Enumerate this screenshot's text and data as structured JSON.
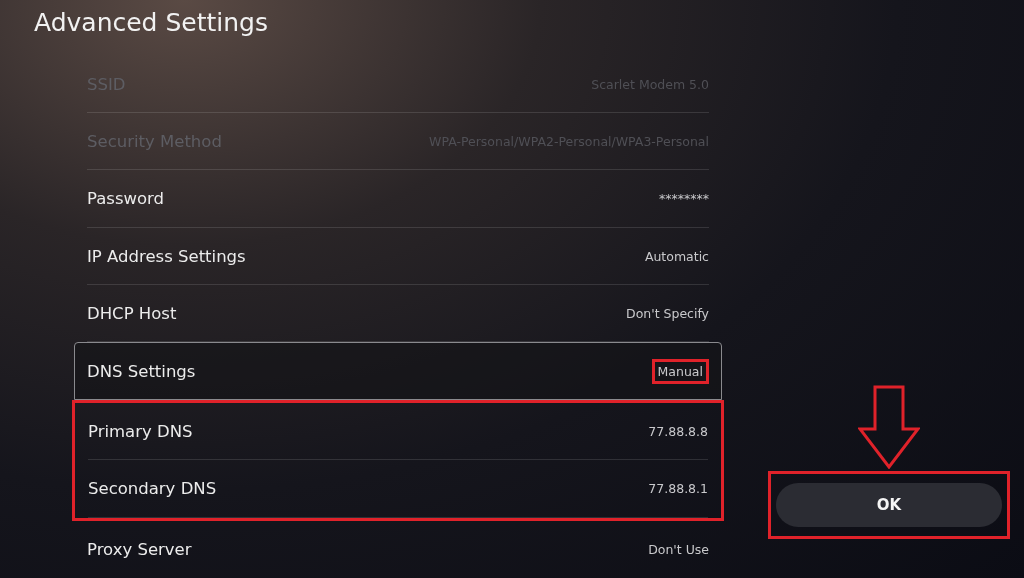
{
  "title": "Advanced Settings",
  "rows": [
    {
      "label": "SSID",
      "value": "Scarlet Modem 5.0",
      "disabled": true,
      "focused": false,
      "value_marked": false,
      "boxed": false
    },
    {
      "label": "Security Method",
      "value": "WPA-Personal/WPA2-Personal/WPA3-Personal",
      "disabled": true,
      "focused": false,
      "value_marked": false,
      "boxed": false
    },
    {
      "label": "Password",
      "value": "********",
      "disabled": false,
      "focused": false,
      "value_marked": false,
      "boxed": false
    },
    {
      "label": "IP Address Settings",
      "value": "Automatic",
      "disabled": false,
      "focused": false,
      "value_marked": false,
      "boxed": false
    },
    {
      "label": "DHCP Host",
      "value": "Don't Specify",
      "disabled": false,
      "focused": false,
      "value_marked": false,
      "boxed": false
    },
    {
      "label": "DNS Settings",
      "value": "Manual",
      "disabled": false,
      "focused": true,
      "value_marked": true,
      "boxed": false
    },
    {
      "label": "Primary DNS",
      "value": "77.88.8.8",
      "disabled": false,
      "focused": false,
      "value_marked": false,
      "boxed": true
    },
    {
      "label": "Secondary DNS",
      "value": "77.88.8.1",
      "disabled": false,
      "focused": false,
      "value_marked": false,
      "boxed": true
    },
    {
      "label": "Proxy Server",
      "value": "Don't Use",
      "disabled": false,
      "focused": false,
      "value_marked": false,
      "boxed": false
    }
  ],
  "ok_button": {
    "label": "OK",
    "marked": true
  }
}
